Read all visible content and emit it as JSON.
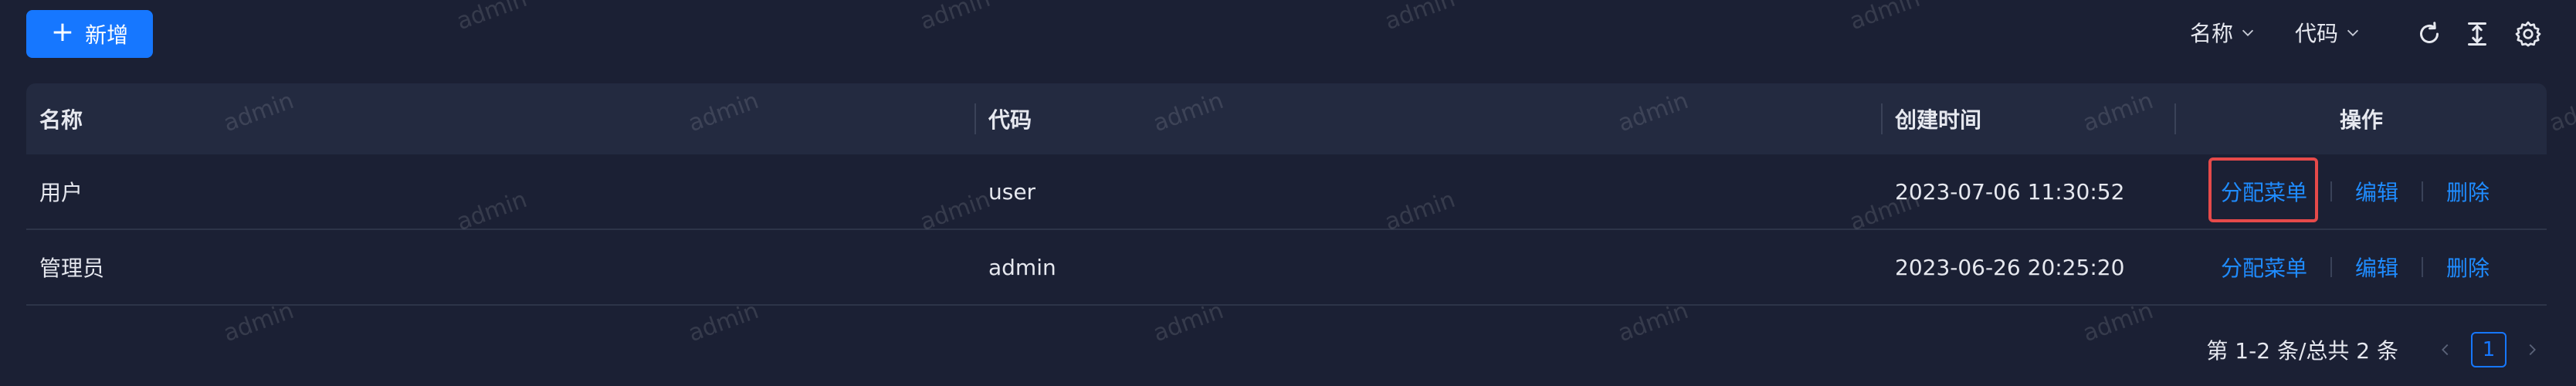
{
  "toolbar": {
    "add_label": "新增",
    "filters": [
      {
        "label": "名称"
      },
      {
        "label": "代码"
      }
    ],
    "icons": [
      "refresh-icon",
      "column-height-icon",
      "settings-icon"
    ]
  },
  "watermark": {
    "text": "admin"
  },
  "table": {
    "columns": [
      {
        "label": "名称"
      },
      {
        "label": "代码"
      },
      {
        "label": "创建时间"
      },
      {
        "label": "操作"
      }
    ],
    "rows": [
      {
        "name": "用户",
        "code": "user",
        "created": "2023-07-06 11:30:52",
        "actions": {
          "assign": "分配菜单",
          "edit": "编辑",
          "delete": "删除"
        }
      },
      {
        "name": "管理员",
        "code": "admin",
        "created": "2023-06-26 20:25:20",
        "actions": {
          "assign": "分配菜单",
          "edit": "编辑",
          "delete": "删除"
        }
      }
    ]
  },
  "pagination": {
    "summary": "第 1-2 条/总共 2 条",
    "current_page": "1"
  },
  "colors": {
    "background": "#1b2034",
    "header_bg": "#232a40",
    "primary": "#1677ff",
    "link": "#1f8cff",
    "highlight": "#e64a4a"
  }
}
